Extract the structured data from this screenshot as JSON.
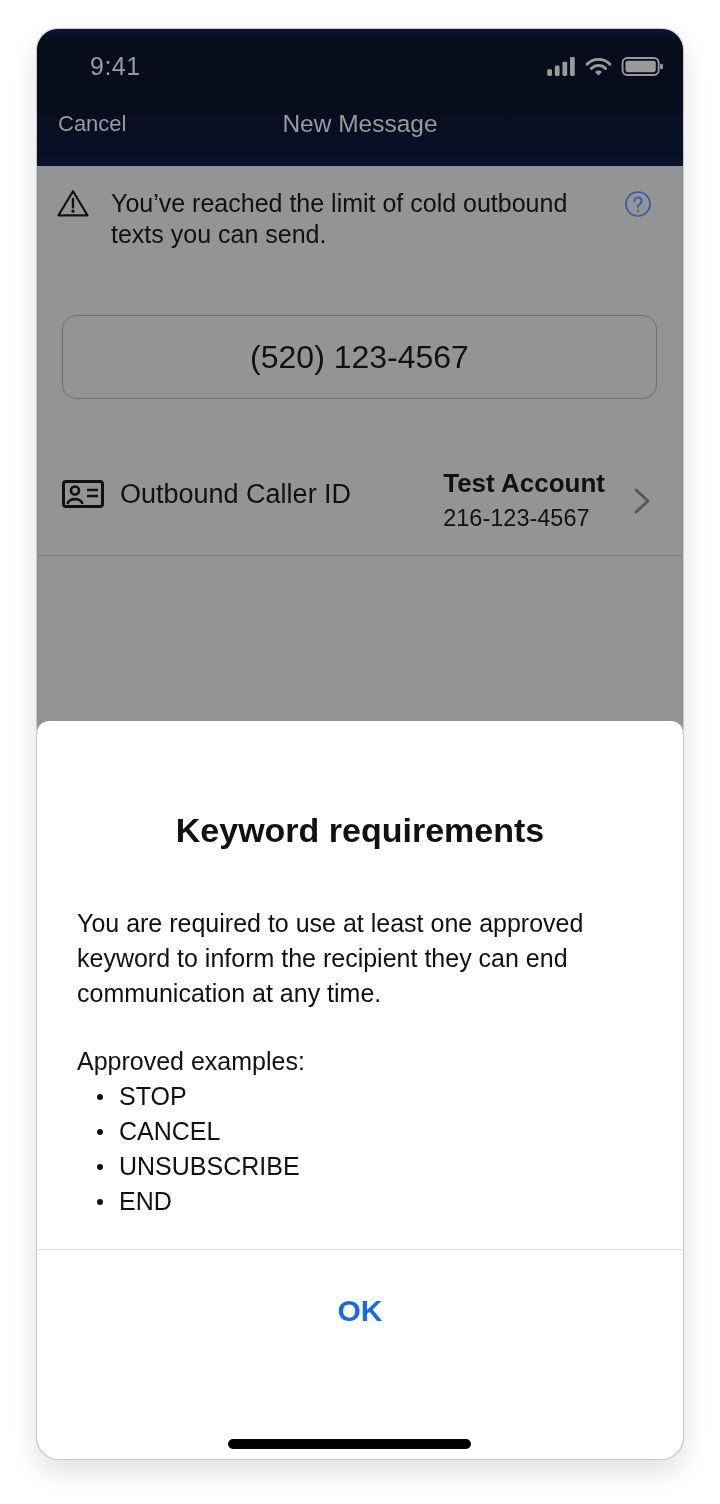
{
  "status_bar": {
    "time": "9:41"
  },
  "nav_bar": {
    "cancel": "Cancel",
    "title": "New Message"
  },
  "alert": {
    "message": "You’ve reached the limit of cold outbound texts you can send."
  },
  "recipient": {
    "value": "(520) 123-4567"
  },
  "caller_id": {
    "label": "Outbound Caller ID",
    "account_name": "Test Account",
    "account_number": "216-123-4567"
  },
  "sheet": {
    "title": "Keyword requirements",
    "body": "You are required to use at least one approved keyword to inform the recipient they can end communication at any time.",
    "examples_label": "Approved examples:",
    "examples": [
      "STOP",
      "CANCEL",
      "UNSUBSCRIBE",
      "END"
    ],
    "button": "OK"
  }
}
